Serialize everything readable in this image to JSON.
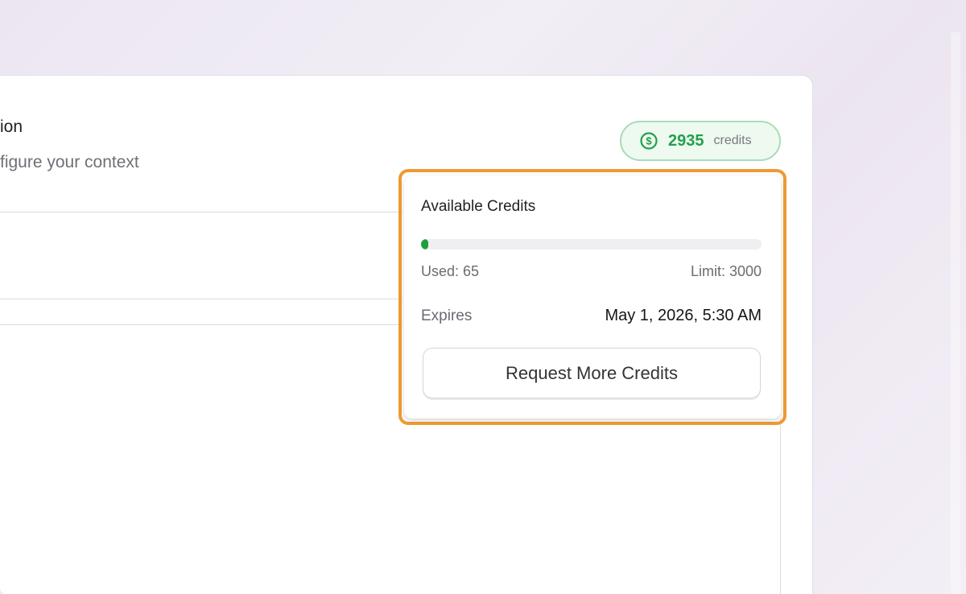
{
  "header": {
    "title_fragment": "ion",
    "subtitle_fragment": "figure your context"
  },
  "credits_badge": {
    "icon": "dollar-circle-icon",
    "value": "2935",
    "unit": "credits",
    "color": "#23a04a"
  },
  "credits_popover": {
    "title": "Available Credits",
    "used_label": "Used: 65",
    "limit_label": "Limit: 3000",
    "used": 65,
    "limit": 3000,
    "expires_label": "Expires",
    "expires_value": "May 1, 2026, 5:30 AM",
    "request_button": "Request More Credits",
    "progress_color": "#1e9e3e",
    "highlight_color": "#ef9a33"
  }
}
